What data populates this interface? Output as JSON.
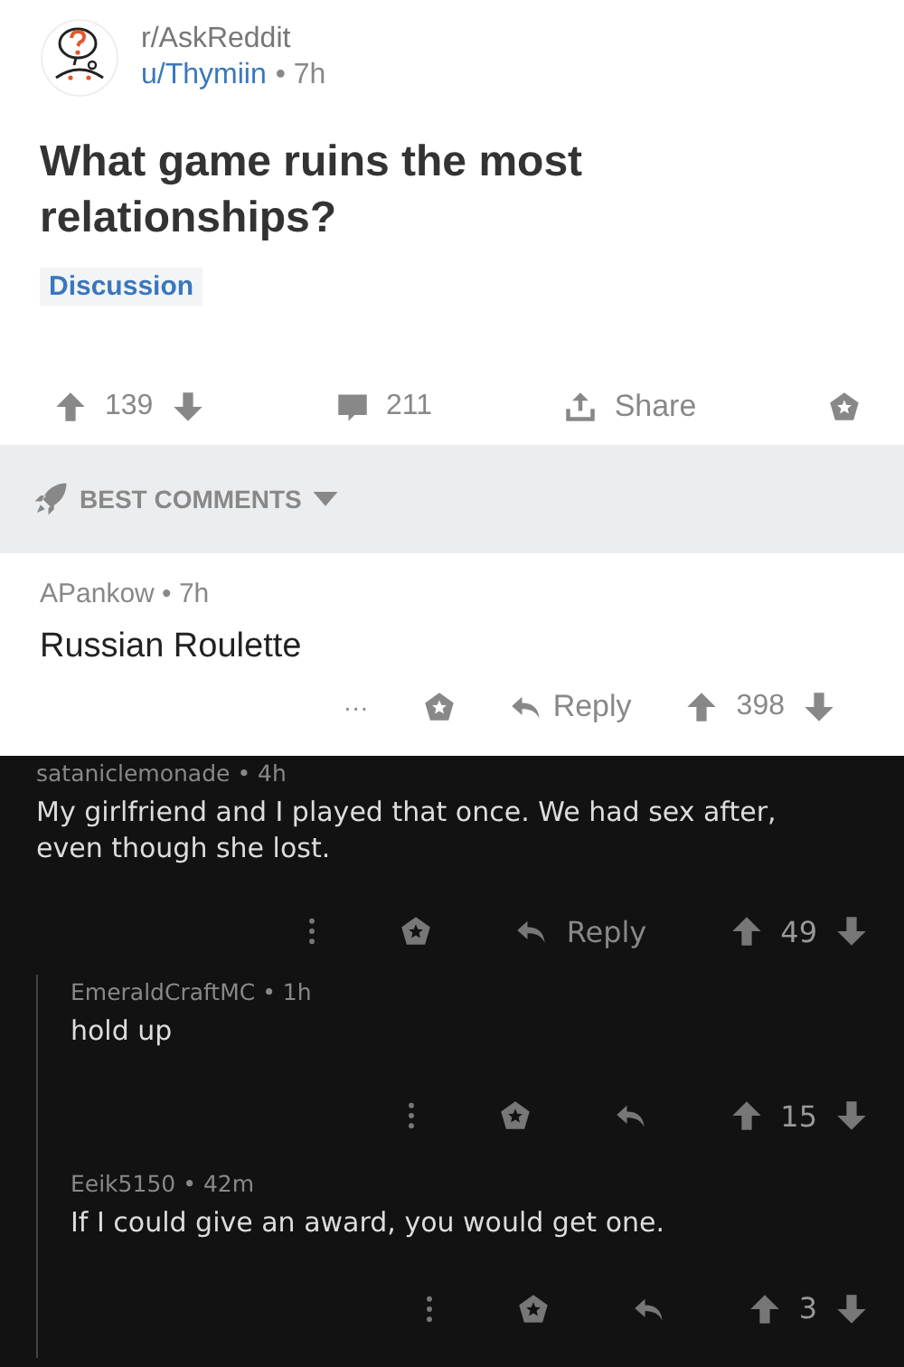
{
  "post": {
    "subreddit": "r/AskReddit",
    "author": "u/Thymiin",
    "age": "• 7h",
    "title": "What game ruins the most relationships?",
    "flair": "Discussion",
    "score": "139",
    "comments": "211",
    "share": "Share"
  },
  "sort": {
    "label": "BEST COMMENTS"
  },
  "comment": {
    "author": "APankow",
    "age": "• 7h",
    "body": "Russian Roulette",
    "menu": "···",
    "reply": "Reply",
    "score": "398"
  },
  "thread": {
    "author": "sataniclemonade",
    "age": "• 4h",
    "body": "My girlfriend and I played that once. We had sex after, even though she lost.",
    "reply": "Reply",
    "score": "49",
    "children": [
      {
        "author": "EmeraldCraftMC",
        "age": "• 1h",
        "body": "hold up",
        "score": "15"
      },
      {
        "author": "Eeik5150",
        "age": "• 42m",
        "body": "If I could give an award, you would get one.",
        "score": "3"
      }
    ]
  }
}
